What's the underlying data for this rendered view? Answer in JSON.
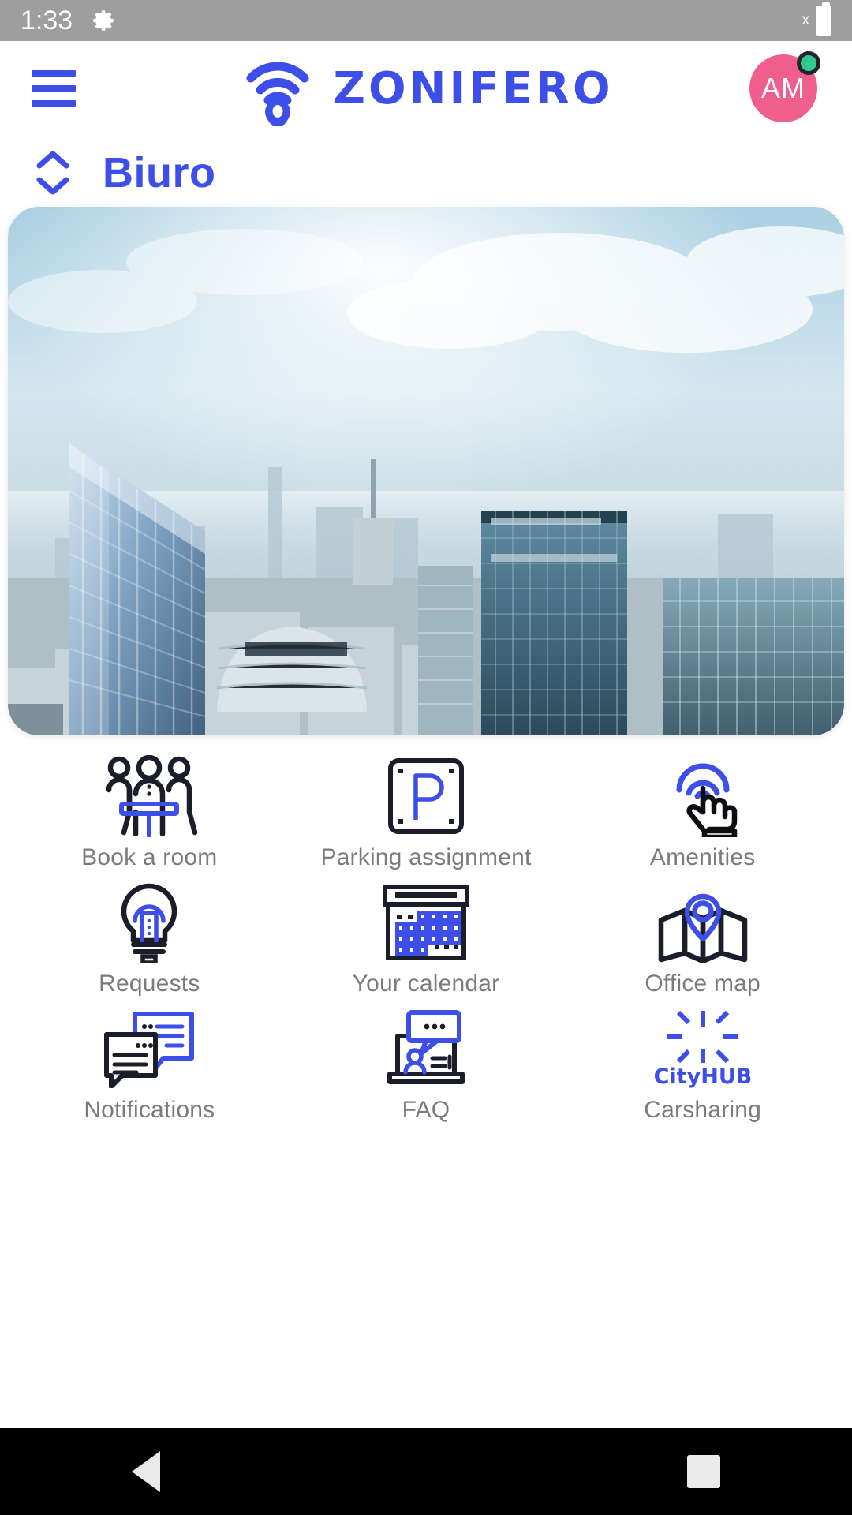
{
  "status_bar": {
    "time": "1:33",
    "gear_icon": "gear-icon",
    "x_label": "x",
    "battery_icon": "battery-icon"
  },
  "app_bar": {
    "menu_icon": "hamburger-menu-icon",
    "logo_icon": "zonifero-wifi-pin-icon",
    "brand": "ZONIFERO",
    "avatar_initials": "AM",
    "presence_status": "online"
  },
  "location_selector": {
    "chevron_icon": "chevron-up-down-icon",
    "name": "Biuro"
  },
  "hero": {
    "alt": "city-skyline-photo"
  },
  "tiles": [
    {
      "label": "Book a room",
      "icon": "people-at-table-icon"
    },
    {
      "label": "Parking assignment",
      "icon": "parking-sign-icon"
    },
    {
      "label": "Amenities",
      "icon": "tap-gesture-icon"
    },
    {
      "label": "Requests",
      "icon": "lightbulb-icon"
    },
    {
      "label": "Your calendar",
      "icon": "calendar-icon"
    },
    {
      "label": "Office map",
      "icon": "folded-map-pin-icon"
    },
    {
      "label": "Notifications",
      "icon": "chat-bubbles-icon"
    },
    {
      "label": "FAQ",
      "icon": "laptop-person-chat-icon"
    },
    {
      "label": "Carsharing",
      "icon": "cityhub-starburst-icon"
    }
  ],
  "cityhub_logo_text": "CityHUB",
  "nav_bar": {
    "back_label": "back-button",
    "home_label": "home-button",
    "recents_label": "recents-button"
  },
  "colors": {
    "brand_blue": "#3d4fe8",
    "icon_dark": "#1b1d2b",
    "avatar_pink": "#ef5e8c",
    "presence_green": "#2ec98b",
    "label_gray": "#7b7b7b",
    "status_gray": "#9e9e9e"
  }
}
